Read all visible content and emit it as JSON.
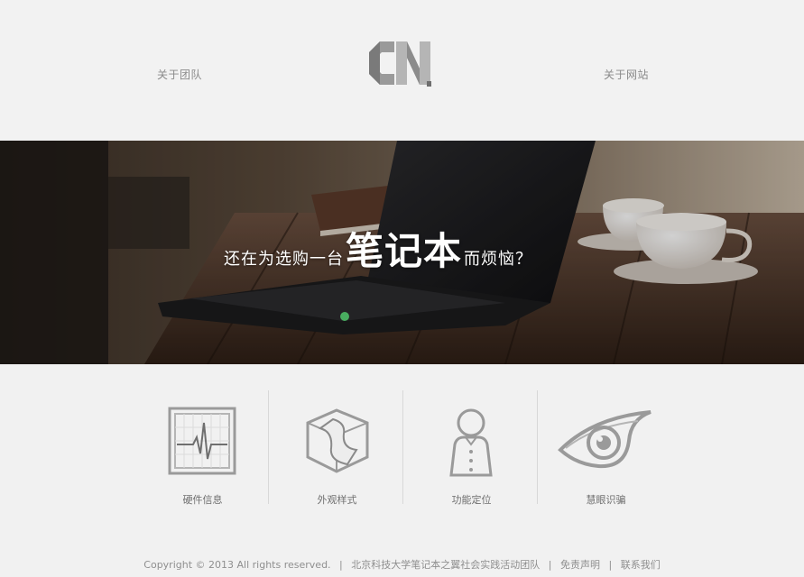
{
  "nav": {
    "left_label": "关于团队",
    "right_label": "关于网站",
    "logo_text": "CN"
  },
  "hero": {
    "tagline_pre": "还在为选购一台",
    "tagline_emphasis": "笔记本",
    "tagline_post": "而烦恼？"
  },
  "features": [
    {
      "label": "硬件信息",
      "icon": "heartbeat-monitor-icon"
    },
    {
      "label": "外观样式",
      "icon": "cube-shape-icon"
    },
    {
      "label": "功能定位",
      "icon": "person-icon"
    },
    {
      "label": "慧眼识骗",
      "icon": "eye-icon"
    }
  ],
  "footer": {
    "copyright": "Copyright © 2013 All rights reserved.",
    "team": "北京科技大学笔记本之翼社会实践活动团队",
    "disclaimer": "免责声明",
    "contact": "联系我们",
    "separator": "|"
  }
}
